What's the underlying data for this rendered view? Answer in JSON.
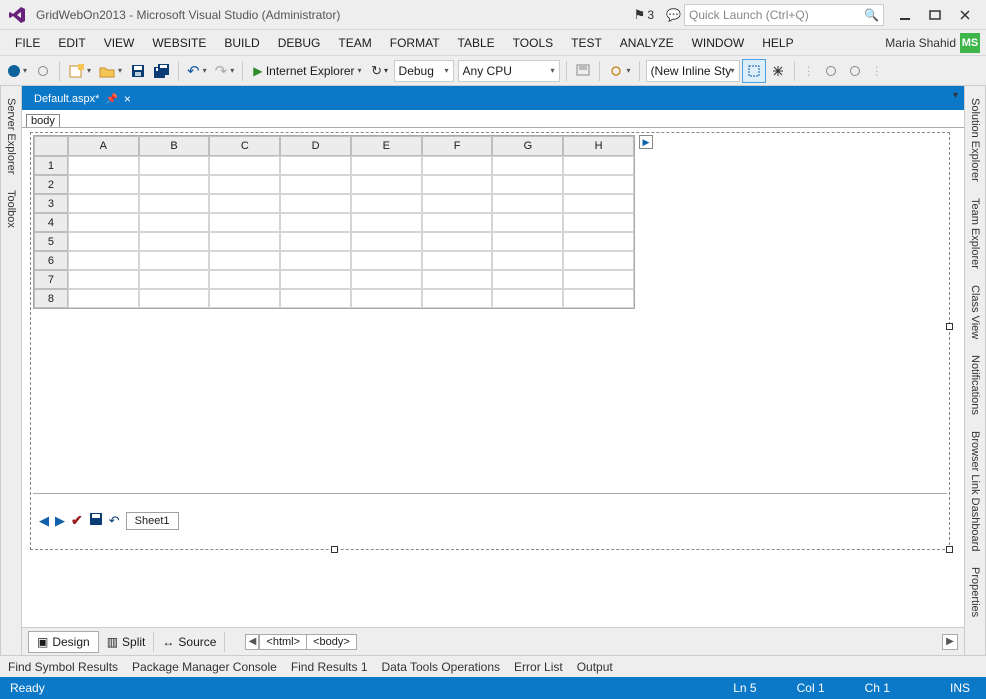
{
  "title": "GridWebOn2013 - Microsoft Visual Studio (Administrator)",
  "notifications": "3",
  "quicklaunch_placeholder": "Quick Launch (Ctrl+Q)",
  "menu": [
    "FILE",
    "EDIT",
    "VIEW",
    "WEBSITE",
    "BUILD",
    "DEBUG",
    "TEAM",
    "FORMAT",
    "TABLE",
    "TOOLS",
    "TEST",
    "ANALYZE",
    "WINDOW",
    "HELP"
  ],
  "user": {
    "name": "Maria Shahid",
    "initials": "MS"
  },
  "toolbar": {
    "run_target": "Internet Explorer",
    "config": "Debug",
    "platform": "Any CPU",
    "style": "(New Inline Style"
  },
  "doc_tab": {
    "name": "Default.aspx*"
  },
  "body_tag": "body",
  "grid": {
    "columns": [
      "A",
      "B",
      "C",
      "D",
      "E",
      "F",
      "G",
      "H"
    ],
    "rows": [
      "1",
      "2",
      "3",
      "4",
      "5",
      "6",
      "7",
      "8"
    ]
  },
  "sheet_name": "Sheet1",
  "view_tabs": {
    "design": "Design",
    "split": "Split",
    "source": "Source"
  },
  "breadcrumb": [
    "<html>",
    "<body>"
  ],
  "panel_tabs": [
    "Find Symbol Results",
    "Package Manager Console",
    "Find Results 1",
    "Data Tools Operations",
    "Error List",
    "Output"
  ],
  "status": {
    "ready": "Ready",
    "ln": "Ln 5",
    "col": "Col 1",
    "ch": "Ch 1",
    "ins": "INS"
  },
  "right_rail": [
    "Solution Explorer",
    "Team Explorer",
    "Class View",
    "Notifications",
    "Browser Link Dashboard",
    "Properties"
  ],
  "left_rail": [
    "Server Explorer",
    "Toolbox"
  ]
}
